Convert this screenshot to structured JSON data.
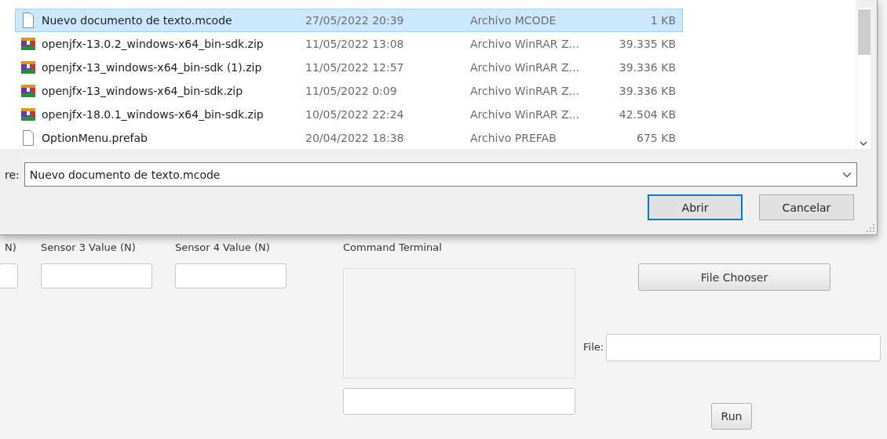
{
  "dialog": {
    "files": [
      {
        "kind": "document",
        "name": "Nuevo documento de texto.mcode",
        "date": "27/05/2022 20:39",
        "type": "Archivo MCODE",
        "size": "1 KB",
        "selected": true
      },
      {
        "kind": "archive",
        "name": "openjfx-13.0.2_windows-x64_bin-sdk.zip",
        "date": "11/05/2022 13:08",
        "type": "Archivo WinRAR Z...",
        "size": "39.335 KB",
        "selected": false
      },
      {
        "kind": "archive",
        "name": "openjfx-13_windows-x64_bin-sdk (1).zip",
        "date": "11/05/2022 12:57",
        "type": "Archivo WinRAR Z...",
        "size": "39.336 KB",
        "selected": false
      },
      {
        "kind": "archive",
        "name": "openjfx-13_windows-x64_bin-sdk.zip",
        "date": "11/05/2022 0:09",
        "type": "Archivo WinRAR Z...",
        "size": "39.336 KB",
        "selected": false
      },
      {
        "kind": "archive",
        "name": "openjfx-18.0.1_windows-x64_bin-sdk.zip",
        "date": "10/05/2022 22:24",
        "type": "Archivo WinRAR Z...",
        "size": "42.504 KB",
        "selected": false
      },
      {
        "kind": "document",
        "name": "OptionMenu.prefab",
        "date": "20/04/2022 18:38",
        "type": "Archivo PREFAB",
        "size": "675 KB",
        "selected": false
      }
    ],
    "filename_label": "re:",
    "filename_value": "Nuevo documento de texto.mcode",
    "buttons": [
      "Abrir",
      "Cancelar"
    ]
  },
  "app": {
    "sensors": [
      {
        "label": "N)"
      },
      {
        "label": "Sensor 3 Value (N)"
      },
      {
        "label": "Sensor 4 Value (N)"
      }
    ],
    "terminal_label": "Command Terminal",
    "file_chooser": "File Chooser",
    "file_label": "File:",
    "run": "Run"
  }
}
